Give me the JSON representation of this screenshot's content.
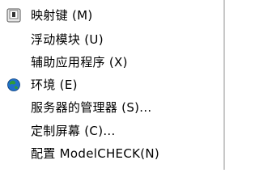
{
  "menu": {
    "items": [
      {
        "label": "映射键 (M)",
        "icon": "keyboard-key-icon"
      },
      {
        "label": "浮动模块 (U)",
        "icon": ""
      },
      {
        "label": "辅助应用程序 (X)",
        "icon": ""
      },
      {
        "label": "环境 (E)",
        "icon": "globe-icon"
      },
      {
        "label": "服务器的管理器 (S)...",
        "icon": ""
      },
      {
        "label": "定制屏幕 (C)...",
        "icon": ""
      },
      {
        "label": "配置 ModelCHECK(N)",
        "icon": ""
      }
    ]
  },
  "colors": {
    "menu_background": "#ffffff",
    "separator": "#c8c8c8",
    "globe_green": "#2e9a3a",
    "globe_blue": "#1f6fc9"
  }
}
